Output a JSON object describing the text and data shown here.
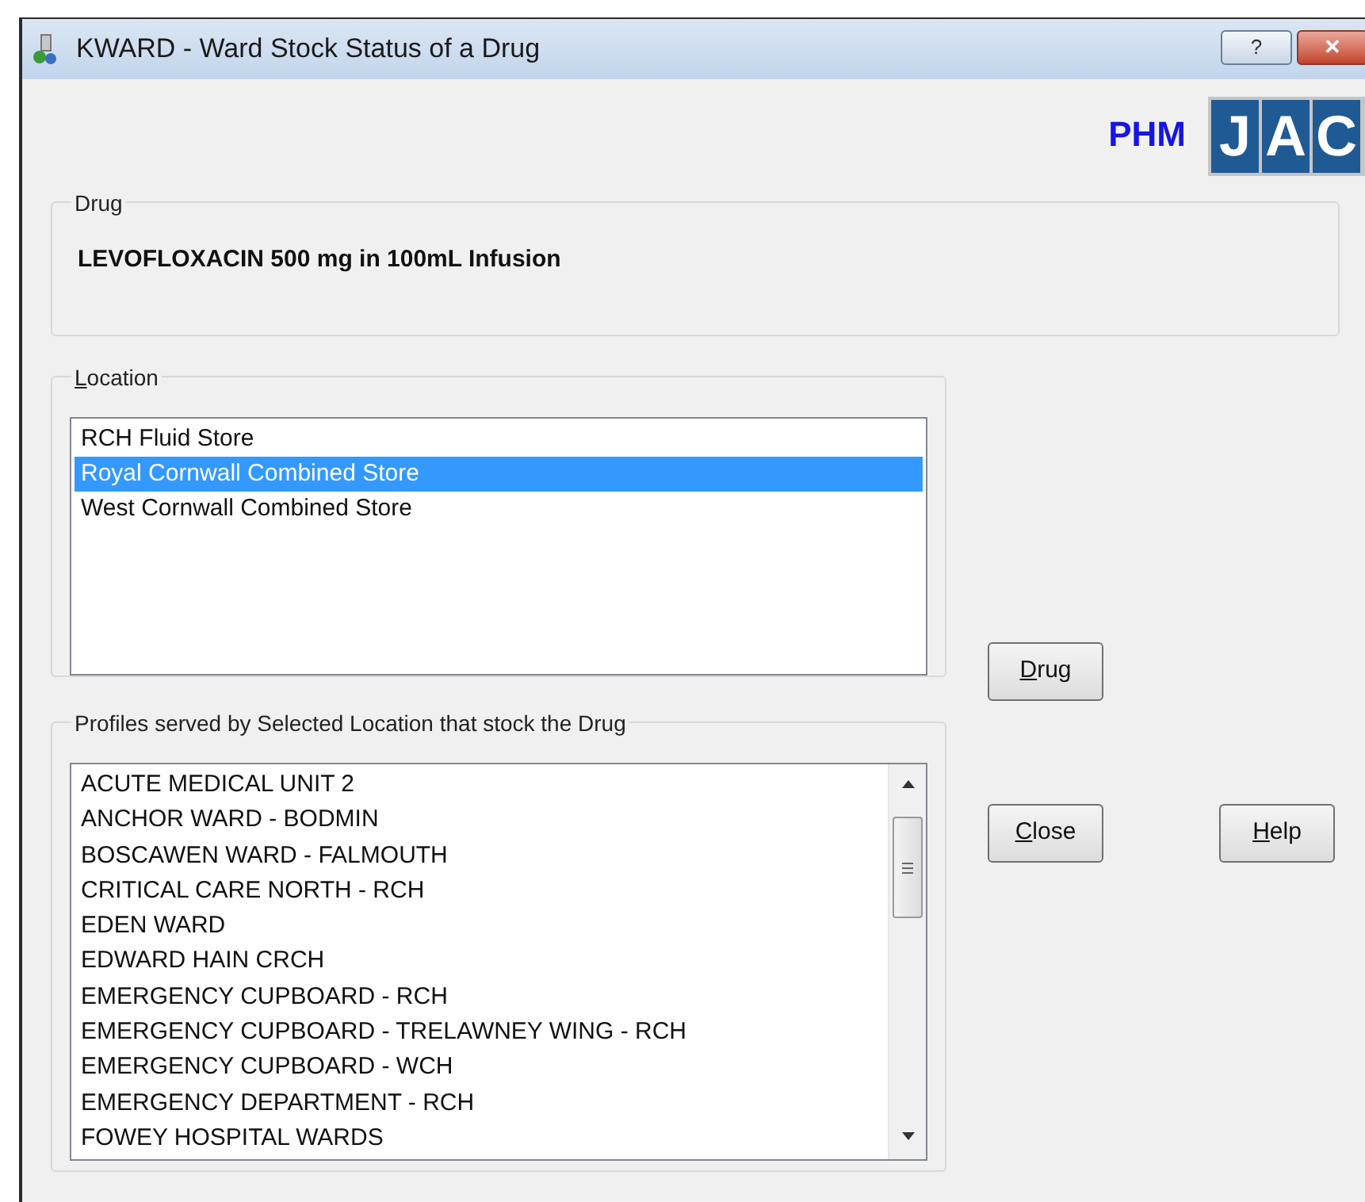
{
  "window": {
    "title": "KWARD - Ward Stock Status of a Drug",
    "title_buttons": [
      "?",
      "✕"
    ]
  },
  "brand": {
    "text": "PHM",
    "logo_letters": [
      "J",
      "A",
      "C"
    ]
  },
  "drug_group": {
    "label": "Drug",
    "value": "LEVOFLOXACIN 500 mg in 100mL Infusion"
  },
  "location_group": {
    "label": "Location",
    "mnemonic_underlined": true,
    "items": [
      {
        "text": "RCH Fluid Store",
        "selected": false
      },
      {
        "text": "Royal Cornwall Combined Store",
        "selected": true
      },
      {
        "text": "West Cornwall Combined Store",
        "selected": false
      }
    ]
  },
  "profiles_group": {
    "label": "Profiles served by Selected Location that stock the Drug",
    "items": [
      {
        "text": "ACUTE MEDICAL UNIT 2"
      },
      {
        "text": "ANCHOR WARD - BODMIN"
      },
      {
        "text": "BOSCAWEN WARD - FALMOUTH"
      },
      {
        "text": "CRITICAL CARE NORTH - RCH"
      },
      {
        "text": "EDEN WARD"
      },
      {
        "text": "EDWARD HAIN CRCH"
      },
      {
        "text": "EMERGENCY CUPBOARD - RCH"
      },
      {
        "text": "EMERGENCY CUPBOARD - TRELAWNEY WING - RCH"
      },
      {
        "text": "EMERGENCY CUPBOARD - WCH"
      },
      {
        "text": "EMERGENCY DEPARTMENT - RCH"
      },
      {
        "text": "FOWEY HOSPITAL WARDS"
      }
    ]
  },
  "buttons": [
    {
      "kind": "drug",
      "label": "Drug",
      "mnemonic_underlined": true
    },
    {
      "kind": "close",
      "label": "Close",
      "mnemonic_underlined": true
    },
    {
      "kind": "help",
      "label": "Help",
      "mnemonic_underlined": true
    }
  ]
}
